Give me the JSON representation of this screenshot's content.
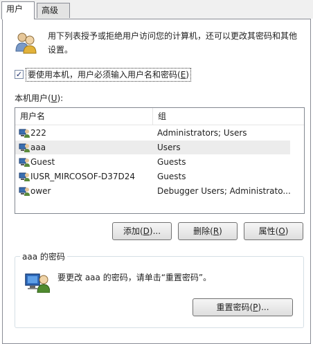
{
  "tabs": [
    {
      "label": "用户"
    },
    {
      "label": "高级"
    }
  ],
  "intro_text": "用下列表授予或拒绝用户访问您的计算机，还可以更改其密码和其他设置。",
  "require_login": {
    "checked": true,
    "label_before": "要使用本机，用户必须输入用户名和密码(",
    "hotkey": "E",
    "label_after": ")"
  },
  "local_users": {
    "label_before": "本机用户(",
    "hotkey": "U",
    "label_after": "):",
    "columns": [
      "用户名",
      "组"
    ],
    "rows": [
      {
        "name": "222",
        "group": "Administrators; Users",
        "selected": false
      },
      {
        "name": "aaa",
        "group": "Users",
        "selected": true
      },
      {
        "name": "Guest",
        "group": "Guests",
        "selected": false
      },
      {
        "name": "IUSR_MIRCOSOF-D37D24",
        "group": "Guests",
        "selected": false
      },
      {
        "name": "ower",
        "group": "Debugger Users; Administrato...",
        "selected": false
      }
    ]
  },
  "buttons": {
    "add": {
      "before": "添加(",
      "hotkey": "D",
      "after": ")..."
    },
    "remove": {
      "before": "删除(",
      "hotkey": "R",
      "after": ")"
    },
    "properties": {
      "before": "属性(",
      "hotkey": "O",
      "after": ")"
    }
  },
  "password_group": {
    "title": "aaa 的密码",
    "text": "要更改 aaa 的密码，请单击“重置密码”。",
    "reset_button": {
      "before": "重置密码(",
      "hotkey": "P",
      "after": ")..."
    }
  },
  "icons": {
    "users_icon": "users-group-icon",
    "user_icon": "user-computer-icon",
    "big_user_icon": "user-password-icon"
  }
}
